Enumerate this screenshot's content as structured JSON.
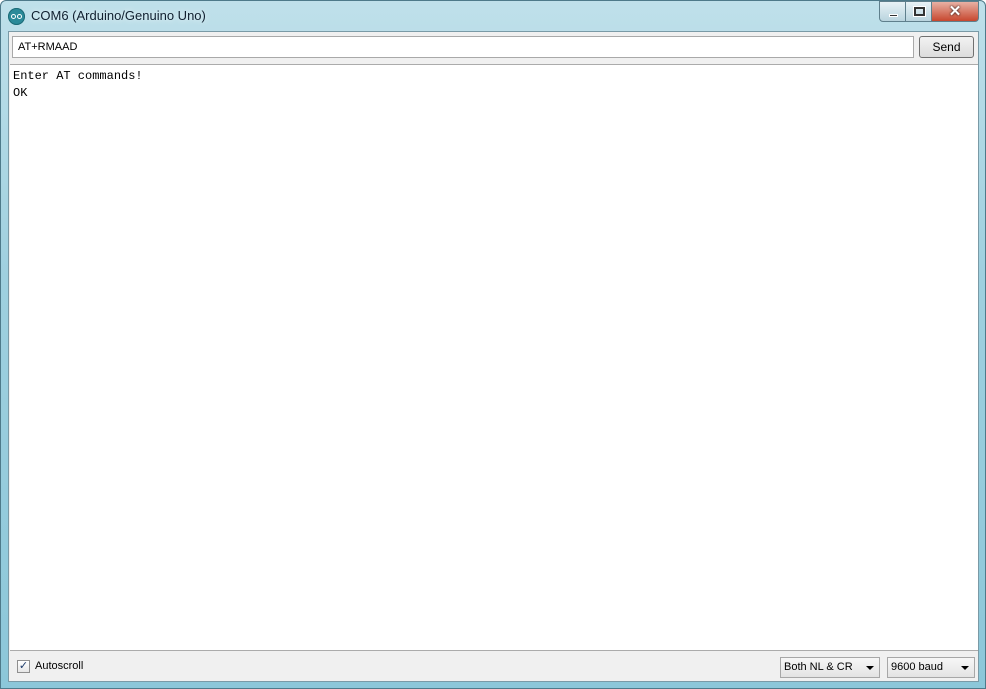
{
  "window": {
    "title": "COM6 (Arduino/Genuino Uno)",
    "close_glyph": "✕",
    "icon": "arduino-icon"
  },
  "input": {
    "value": "AT+RMAAD"
  },
  "send_label": "Send",
  "output_lines": [
    "Enter AT commands!",
    "OK"
  ],
  "footer": {
    "autoscroll_label": "Autoscroll",
    "autoscroll_checked": true,
    "line_ending": "Both NL & CR",
    "baud": "9600 baud"
  },
  "colors": {
    "title_bar": "#9fd0df",
    "close_button": "#c7472e"
  }
}
